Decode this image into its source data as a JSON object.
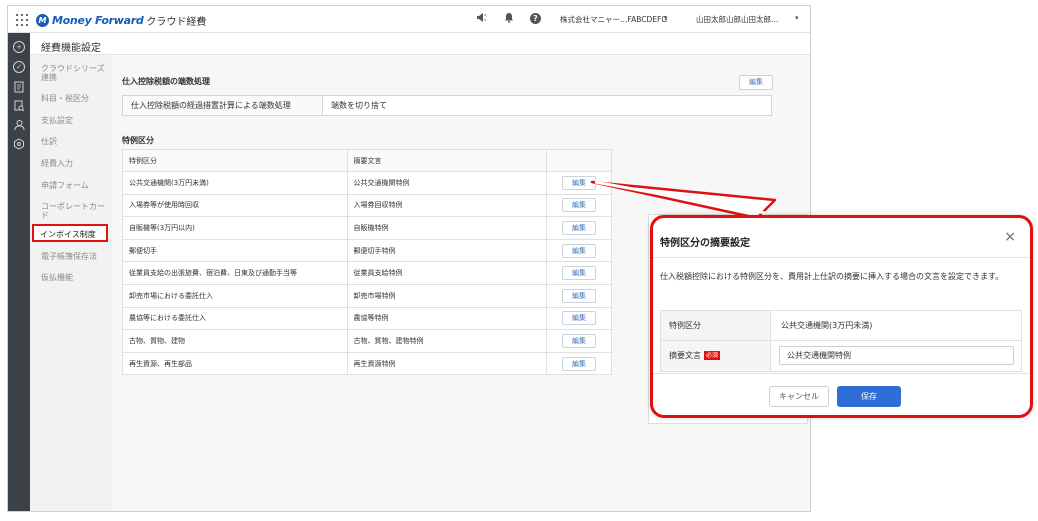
{
  "topbar": {
    "brand_logo": "M",
    "brand_name": "Money Forward",
    "product_name": "クラウド経費",
    "company": "株式会社マニャー…FABCDEFG",
    "user": "山田太郎山郎山田太郎…",
    "help_glyph": "?"
  },
  "page": {
    "title": "経費機能設定"
  },
  "sidebar": {
    "items": [
      {
        "label": "クラウドシリーズ連携"
      },
      {
        "label": "科目・税区分"
      },
      {
        "label": "支払設定"
      },
      {
        "label": "仕訳"
      },
      {
        "label": "経費入力"
      },
      {
        "label": "申請フォーム"
      },
      {
        "label": "コーポレートカード"
      },
      {
        "label": "インボイス制度"
      },
      {
        "label": "電子帳簿保存法"
      },
      {
        "label": "仮払機能"
      }
    ],
    "active_label": "インボイス制度"
  },
  "rounding": {
    "title": "仕入控除税額の端数処理",
    "edit_label": "編集",
    "row_label": "仕入控除税額の経過措置計算による端数処理",
    "row_value": "端数を切り捨て"
  },
  "special": {
    "title": "特例区分",
    "columns": [
      "特例区分",
      "摘要文言",
      ""
    ],
    "edit_label": "編集",
    "rows": [
      {
        "category": "公共交通機関(3万円未満)",
        "text": "公共交通機関特例"
      },
      {
        "category": "入場券等が使用時回収",
        "text": "入場券回収特例"
      },
      {
        "category": "自販機等(3万円以内)",
        "text": "自販機特例"
      },
      {
        "category": "郵便切手",
        "text": "郵便切手特例"
      },
      {
        "category": "従業員支給の出張旅費、宿泊費、日東及び通勤手当等",
        "text": "従業員支給特例"
      },
      {
        "category": "卸売市場における委託仕入",
        "text": "卸売市場特例"
      },
      {
        "category": "農協等における委託仕入",
        "text": "農協等特例"
      },
      {
        "category": "古物、質物、建物",
        "text": "古物、質物、建物特例"
      },
      {
        "category": "再生資源、再生部品",
        "text": "再生資源特例"
      }
    ]
  },
  "modal": {
    "title": "特例区分の摘要設定",
    "close_glyph": "×",
    "description": "仕入税額控除における特例区分を、費用計上仕訳の摘要に挿入する場合の文言を設定できます。",
    "category_label": "特例区分",
    "category_value": "公共交通機関(3万円未満)",
    "text_label": "摘要文言",
    "required_badge": "必須",
    "text_value": "公共交通機関特例",
    "cancel_label": "キャンセル",
    "save_label": "保存"
  },
  "colors": {
    "highlight": "#e01010",
    "primary": "#2e6ed6",
    "rail": "#3d4249"
  }
}
